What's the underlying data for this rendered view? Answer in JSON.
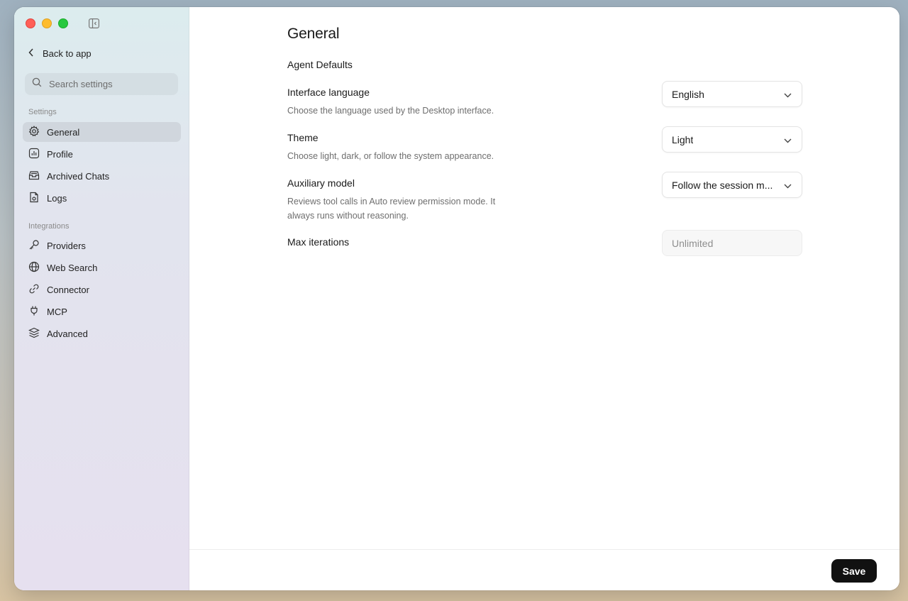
{
  "window": {
    "traffic_lights": [
      "close",
      "minimize",
      "zoom"
    ]
  },
  "sidebar": {
    "back_label": "Back to app",
    "search_placeholder": "Search settings",
    "settings_label": "Settings",
    "settings_items": [
      {
        "label": "General",
        "icon": "gear-icon",
        "active": true
      },
      {
        "label": "Profile",
        "icon": "chart-icon",
        "active": false
      },
      {
        "label": "Archived Chats",
        "icon": "archive-icon",
        "active": false
      },
      {
        "label": "Logs",
        "icon": "document-icon",
        "active": false
      }
    ],
    "integrations_label": "Integrations",
    "integration_items": [
      {
        "label": "Providers",
        "icon": "key-icon"
      },
      {
        "label": "Web Search",
        "icon": "globe-icon"
      },
      {
        "label": "Connector",
        "icon": "link-icon"
      },
      {
        "label": "MCP",
        "icon": "plug-icon"
      },
      {
        "label": "Advanced",
        "icon": "layers-icon"
      }
    ]
  },
  "main": {
    "title": "General",
    "section_title": "Agent Defaults",
    "settings": [
      {
        "title": "Interface language",
        "description": "Choose the language used by the Desktop interface.",
        "value": "English"
      },
      {
        "title": "Theme",
        "description": "Choose light, dark, or follow the system appearance.",
        "value": "Light"
      },
      {
        "title": "Auxiliary model",
        "description": "Reviews tool calls in Auto review permission mode. It always runs without reasoning.",
        "value": "Follow the session m..."
      },
      {
        "title": "Max iterations",
        "description": "",
        "placeholder": "Unlimited"
      }
    ]
  },
  "footer": {
    "save_label": "Save"
  }
}
